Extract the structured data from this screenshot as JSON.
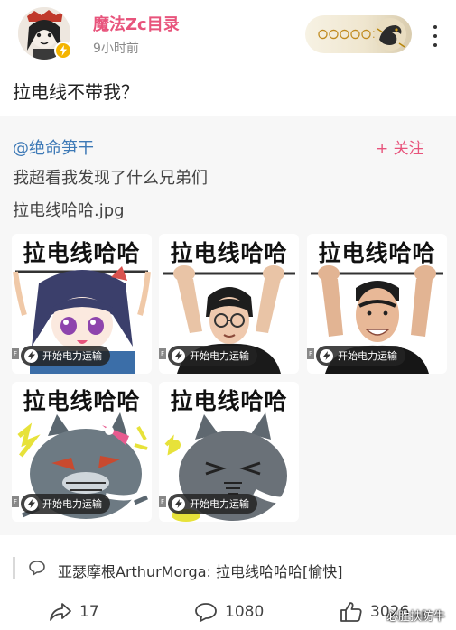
{
  "post": {
    "user_name": "魔法Zc目录",
    "time": "9小时前",
    "text": "拉电线不带我？",
    "fan_badge_text": "〇〇〇〇〇1"
  },
  "repost": {
    "author": "@绝命笋干",
    "follow_label": "+ 关注",
    "text_line1": "我超看我发现了什么兄弟们",
    "text_line2": "拉电线哈哈.jpg",
    "stickers": [
      {
        "title": "拉电线哈哈",
        "chip": "开始电力运输",
        "subject": "anime-girl"
      },
      {
        "title": "拉电线哈哈",
        "chip": "开始电力运输",
        "subject": "man-glasses"
      },
      {
        "title": "拉电线哈哈",
        "chip": "开始电力运输",
        "subject": "man-smiling"
      },
      {
        "title": "拉电线哈哈",
        "chip": "开始电力运输",
        "subject": "grey-cat-ribbon"
      },
      {
        "title": "拉电线哈哈",
        "chip": "开始电力运输",
        "subject": "grey-cat"
      }
    ]
  },
  "comment": {
    "text": "亚瑟摩根ArthurMorga: 拉电线哈哈哈[愉快]"
  },
  "actions": {
    "share_count": "17",
    "comment_count": "1080",
    "like_count": "3026"
  },
  "watermark": "必胜扶防牛",
  "colors": {
    "username": "#e8547c",
    "link": "#3d79b6",
    "follow": "#e8547c",
    "card_bg": "#f7f7f7"
  }
}
